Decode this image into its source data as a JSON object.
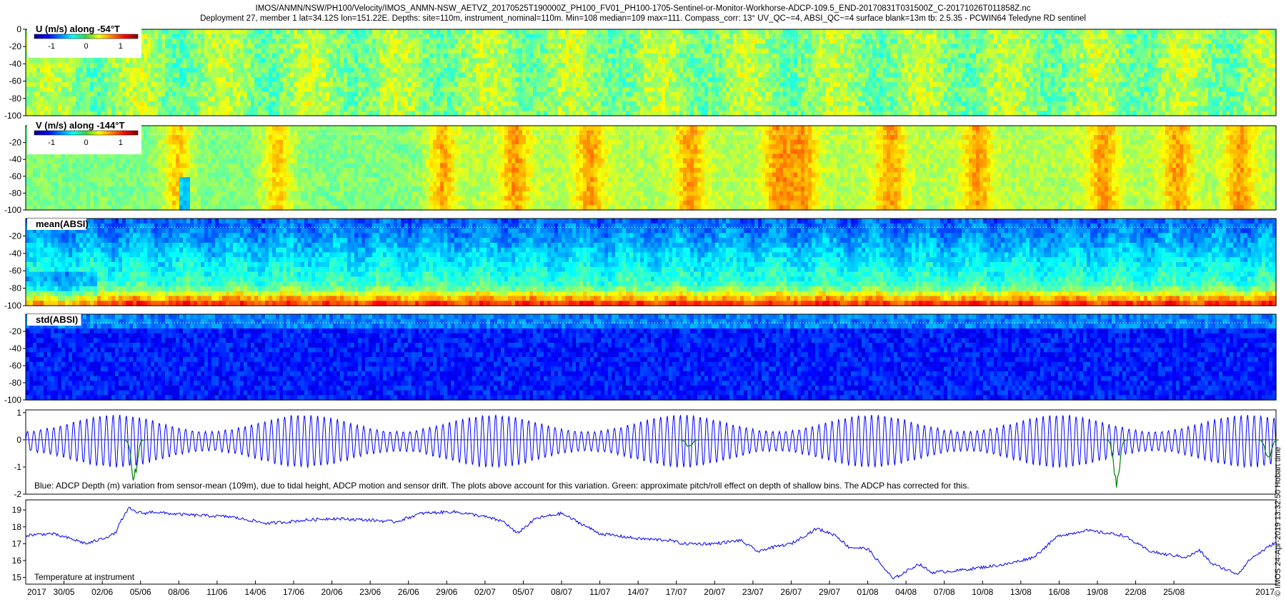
{
  "header": {
    "line1": "IMOS/ANMN/NSW/PH100/Velocity/IMOS_ANMN-NSW_AETVZ_20170525T190000Z_PH100_FV01_PH100-1705-Sentinel-or-Monitor-Workhorse-ADCP-109.5_END-20170831T031500Z_C-20171026T011858Z.nc",
    "line2": "Deployment 27, member 1 lat=34.12S lon=151.22E. Depths: site=110m, instrument_nominal=110m. Min=108 median=109 max=111. Compass_corr: 13° UV_QC~=4, ABSI_QC~=4 surface blank=13m tb: 2.5.35 - PCWIN64 Teledyne RD sentinel"
  },
  "side_label": "© IMOS 24-Apr-2019 13:32:50 Hobart time",
  "chart_data": [
    {
      "type": "heatmap",
      "title": "U (m/s) along -54°T",
      "y_ticks": [
        0,
        -20,
        -40,
        -60,
        -80,
        -100
      ],
      "ylim": [
        -100,
        0
      ],
      "colorbar": {
        "ticks": [
          "-1",
          "0",
          "1"
        ],
        "range": [
          -1.5,
          1.5
        ],
        "colormap": "jet"
      },
      "dominant": "green (near 0 m/s)"
    },
    {
      "type": "heatmap",
      "title": "V (m/s) along -144°T",
      "y_ticks": [
        -20,
        -40,
        -60,
        -80,
        -100
      ],
      "ylim": [
        -100,
        0
      ],
      "colorbar": {
        "ticks": [
          "-1",
          "0",
          "1"
        ],
        "range": [
          -1.5,
          1.5
        ],
        "colormap": "jet"
      },
      "dominant": "green with yellow/orange bands (0 to 0.8 m/s)"
    },
    {
      "type": "heatmap",
      "title": "mean(ABSI)",
      "y_ticks": [
        -20,
        -40,
        -60,
        -80,
        -100
      ],
      "ylim": [
        -100,
        0
      ],
      "colormap": "jet",
      "dominant": "blue near surface, orange/red near bottom"
    },
    {
      "type": "heatmap",
      "title": "std(ABSI)",
      "y_ticks": [
        -20,
        -40,
        -60,
        -80,
        -100
      ],
      "ylim": [
        -100,
        0
      ],
      "colormap": "jet",
      "dominant": "dark blue throughout"
    },
    {
      "type": "line",
      "annotation": "Blue: ADCP Depth (m) variation from sensor-mean (109m), due to tidal height, ADCP motion and sensor drift. The plots above account for this variation. Green: approximate pitch/roll effect on depth of shallow bins. The ADCP has corrected for this.",
      "y_ticks": [
        1,
        0,
        -1,
        -2
      ],
      "ylim": [
        -2,
        1.1
      ],
      "x_range_days": [
        0,
        98
      ],
      "series": [
        {
          "color": "#0000ff",
          "kind": "tidal oscillation",
          "period_days": 0.517,
          "amplitude_min": 0.35,
          "amplitude_max": 0.95
        },
        {
          "color": "#008000",
          "kind": "pitch/roll spikes",
          "spikes": [
            {
              "day": 8.5,
              "depth": -1.6
            },
            {
              "day": 52.0,
              "depth": -0.3
            },
            {
              "day": 85.5,
              "depth": -1.9
            },
            {
              "day": 97.4,
              "depth": -0.8
            }
          ]
        }
      ]
    },
    {
      "type": "line",
      "annotation": "Temperature at instrument",
      "y_ticks": [
        19,
        18,
        17,
        16,
        15
      ],
      "ylim": [
        14.6,
        19.6
      ],
      "x_range_days": [
        0,
        98
      ],
      "series": [
        {
          "color": "#0000ff",
          "x": [
            0,
            2,
            3.5,
            4.8,
            6,
            7,
            7.5,
            8.1,
            8.6,
            9.3,
            10,
            11,
            13,
            16,
            19,
            22,
            24,
            27,
            29,
            31,
            33.5,
            34.5,
            36,
            37.5,
            38.5,
            40,
            42,
            45,
            48,
            50.5,
            51.5,
            54,
            56,
            57.5,
            58,
            60,
            62,
            63.5,
            64.5,
            66,
            68,
            70,
            71,
            73,
            75,
            77,
            79,
            81,
            82,
            83,
            85,
            86,
            88,
            89,
            90,
            91,
            92,
            93,
            95,
            96,
            98
          ],
          "y": [
            17.5,
            17.6,
            17.3,
            17.0,
            17.3,
            17.6,
            18.4,
            19.1,
            18.9,
            18.8,
            18.9,
            18.8,
            18.7,
            18.6,
            18.2,
            18.4,
            18.5,
            18.4,
            18.3,
            18.8,
            18.9,
            18.8,
            18.6,
            18.3,
            17.6,
            18.5,
            18.8,
            17.6,
            17.3,
            17.2,
            17.0,
            17.0,
            17.2,
            16.5,
            16.7,
            17.0,
            17.9,
            17.5,
            16.8,
            16.7,
            14.9,
            15.8,
            15.3,
            15.4,
            15.6,
            15.8,
            16.2,
            17.5,
            17.6,
            17.8,
            17.6,
            17.5,
            16.6,
            16.4,
            16.3,
            16.2,
            16.6,
            15.8,
            15.2,
            16.1,
            17.1
          ]
        }
      ]
    }
  ],
  "x_axis": {
    "ticks": [
      {
        "label": "2017",
        "day": 0
      },
      {
        "label": "30/05",
        "day": 3
      },
      {
        "label": "02/06",
        "day": 6
      },
      {
        "label": "05/06",
        "day": 9
      },
      {
        "label": "08/06",
        "day": 12
      },
      {
        "label": "11/06",
        "day": 15
      },
      {
        "label": "14/06",
        "day": 18
      },
      {
        "label": "17/06",
        "day": 21
      },
      {
        "label": "20/06",
        "day": 24
      },
      {
        "label": "23/06",
        "day": 27
      },
      {
        "label": "26/06",
        "day": 30
      },
      {
        "label": "29/06",
        "day": 33
      },
      {
        "label": "02/07",
        "day": 36
      },
      {
        "label": "05/07",
        "day": 39
      },
      {
        "label": "08/07",
        "day": 42
      },
      {
        "label": "11/07",
        "day": 45
      },
      {
        "label": "14/07",
        "day": 48
      },
      {
        "label": "17/07",
        "day": 51
      },
      {
        "label": "20/07",
        "day": 54
      },
      {
        "label": "23/07",
        "day": 57
      },
      {
        "label": "26/07",
        "day": 60
      },
      {
        "label": "29/07",
        "day": 63
      },
      {
        "label": "01/08",
        "day": 66
      },
      {
        "label": "04/08",
        "day": 69
      },
      {
        "label": "07/08",
        "day": 72
      },
      {
        "label": "10/08",
        "day": 75
      },
      {
        "label": "13/08",
        "day": 78
      },
      {
        "label": "16/08",
        "day": 81
      },
      {
        "label": "19/08",
        "day": 84
      },
      {
        "label": "22/08",
        "day": 87
      },
      {
        "label": "25/08",
        "day": 90
      },
      {
        "label": "2017",
        "day": 98
      }
    ]
  }
}
